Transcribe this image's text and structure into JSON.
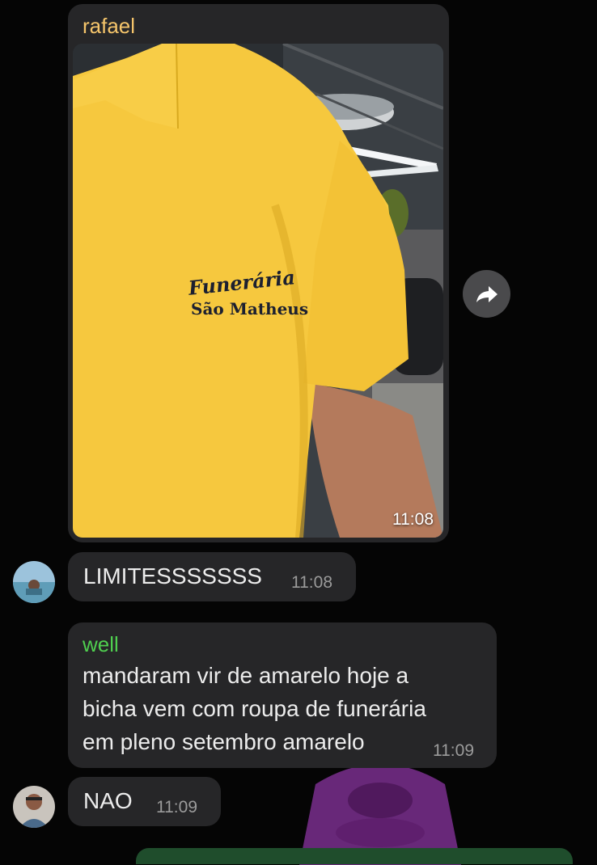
{
  "messages": [
    {
      "sender": "rafael",
      "type": "photo",
      "time": "11:08",
      "photo": {
        "embroidery_line1": "Funerária",
        "embroidery_line2": "São Matheus"
      }
    },
    {
      "type": "text",
      "text": "LIMITESSSSSSS",
      "time": "11:08"
    },
    {
      "sender": "well",
      "type": "text",
      "text": "mandaram vir de amarelo hoje a\nbicha vem com roupa de funerária\nem pleno setembro amarelo",
      "time": "11:09"
    },
    {
      "type": "text",
      "text": "NAO",
      "time": "11:09"
    }
  ],
  "colors": {
    "sender_rafael": "#f5c56b",
    "sender_well": "#4fcf4f",
    "bubble": "#262628",
    "shirt": "#f6c83e"
  },
  "icons": {
    "forward": "forward-arrow-icon"
  }
}
